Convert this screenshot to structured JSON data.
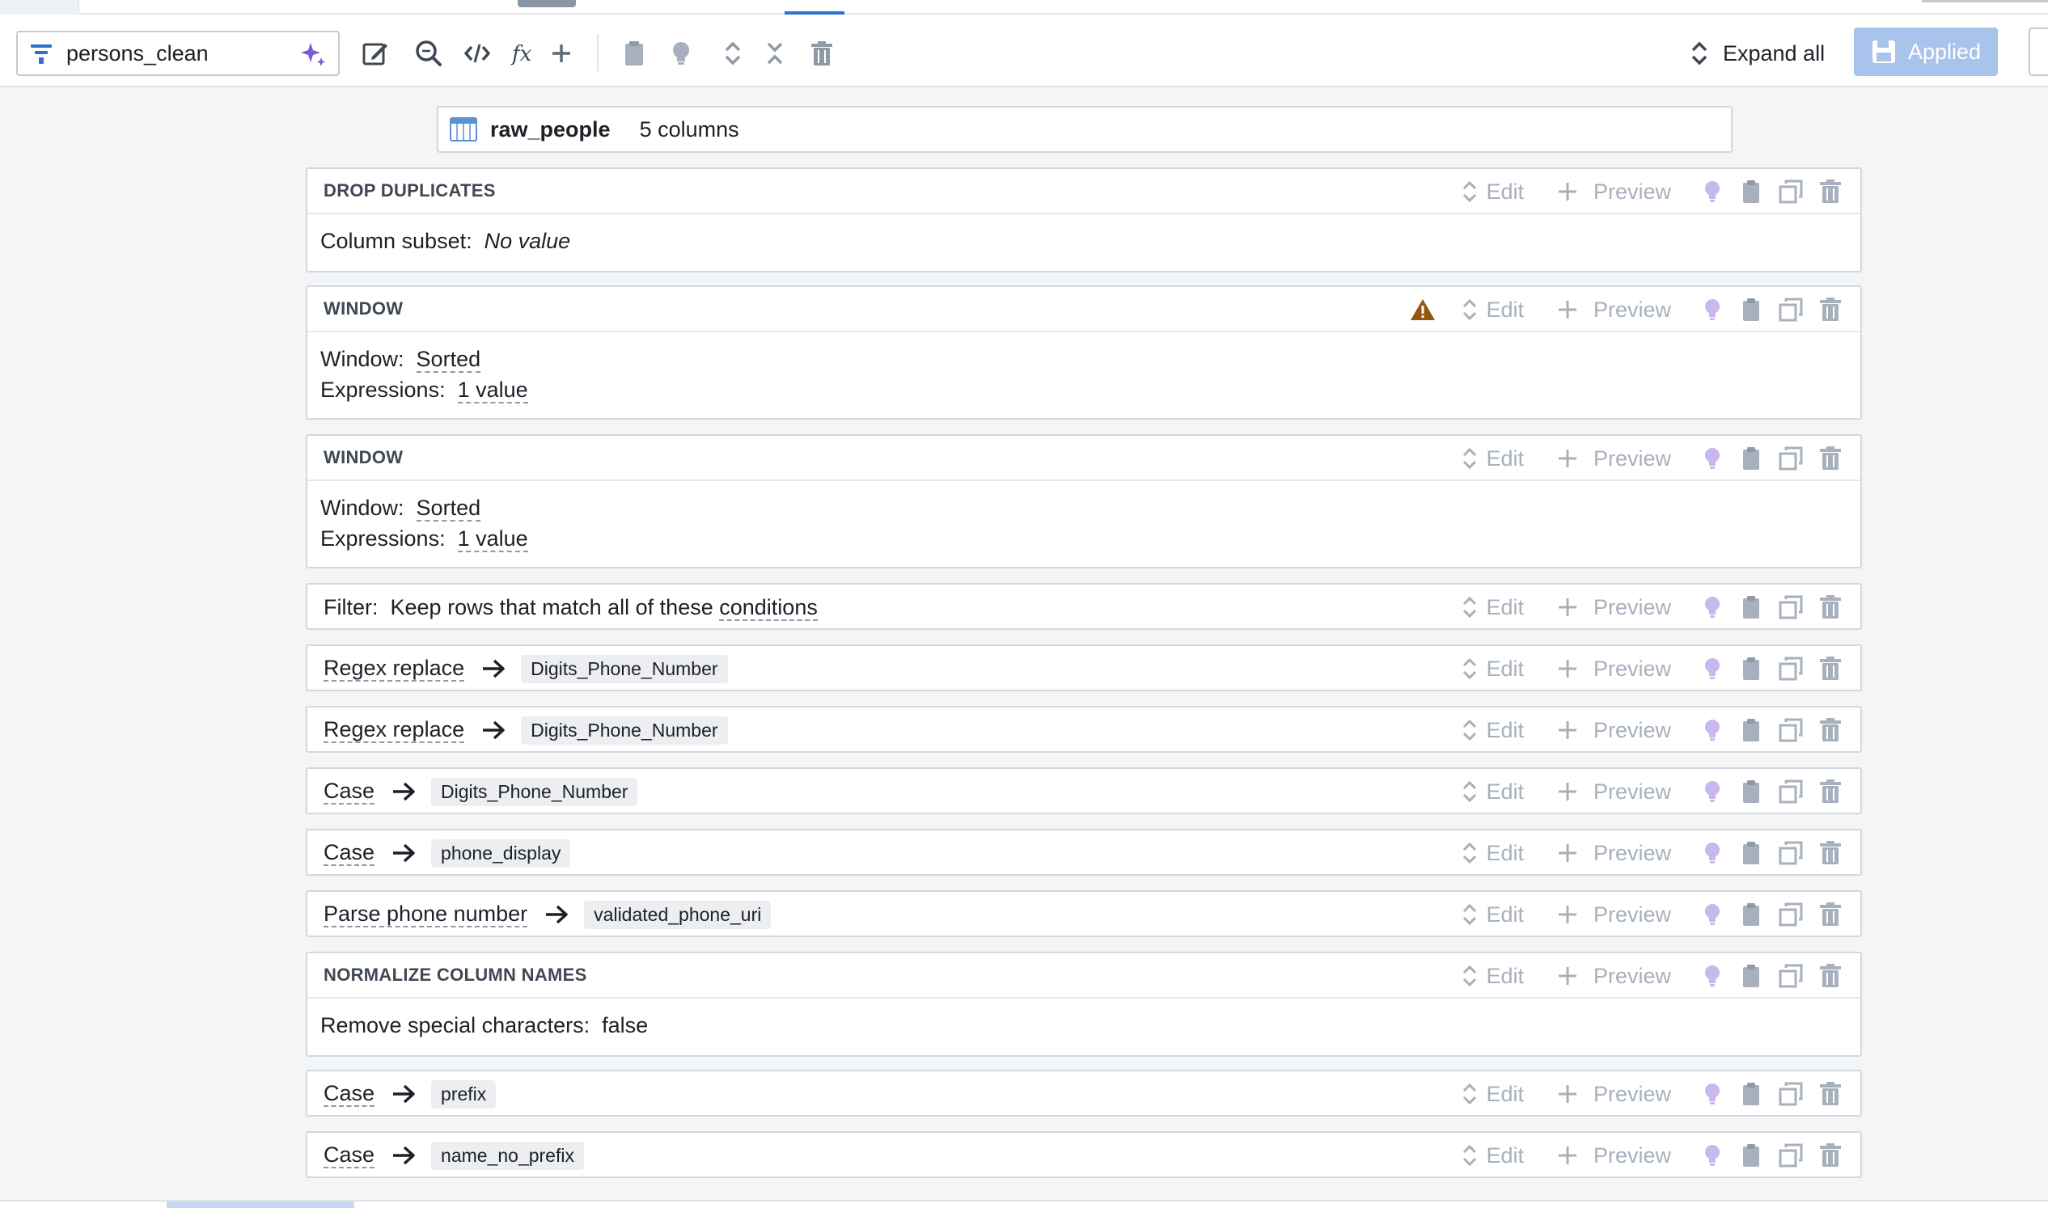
{
  "toolbar": {
    "transform_name": "persons_clean",
    "expand_all_label": "Expand all",
    "applied_label": "Applied"
  },
  "source": {
    "name": "raw_people",
    "columns_label": "5 columns"
  },
  "action_labels": {
    "edit": "Edit",
    "preview": "Preview"
  },
  "steps": [
    {
      "title": "DROP DUPLICATES",
      "body": [
        {
          "key": "Column subset:",
          "value": "No value"
        }
      ]
    },
    {
      "title": "WINDOW",
      "warning": true,
      "body": [
        {
          "key": "Window:",
          "value": "Sorted"
        },
        {
          "key": "Expressions:",
          "value": "1 value"
        }
      ]
    },
    {
      "title": "WINDOW",
      "body": [
        {
          "key": "Window:",
          "value": "Sorted"
        },
        {
          "key": "Expressions:",
          "value": "1 value"
        }
      ]
    },
    {
      "filter_prefix": "Filter:",
      "filter_text": "Keep rows that match all of these",
      "filter_link": "conditions"
    },
    {
      "label": "Regex replace",
      "target": "Digits_Phone_Number"
    },
    {
      "label": "Regex replace",
      "target": "Digits_Phone_Number"
    },
    {
      "label": "Case",
      "target": "Digits_Phone_Number"
    },
    {
      "label": "Case",
      "target": "phone_display"
    },
    {
      "label": "Parse phone number",
      "target": "validated_phone_uri"
    },
    {
      "title": "NORMALIZE COLUMN NAMES",
      "body": [
        {
          "key": "Remove special characters:",
          "value": "false"
        }
      ]
    },
    {
      "label": "Case",
      "target": "prefix"
    },
    {
      "label": "Case",
      "target": "name_no_prefix"
    }
  ],
  "colors": {
    "accent": "#2d72d2",
    "applied_bg": "#a8c4ec",
    "warning": "#935610",
    "disabled_action": "#a7b0bc",
    "lightbulb": "#c9b8ee"
  },
  "icons": [
    "filter-lines-icon",
    "sparkle-icon",
    "edit-icon",
    "search-icon",
    "code-icon",
    "function-icon",
    "plus-icon",
    "clipboard-icon",
    "lightbulb-icon",
    "expand-icon",
    "collapse-icon",
    "trash-icon",
    "table-icon",
    "warning-icon",
    "arrow-right-icon",
    "duplicate-icon",
    "save-icon"
  ]
}
